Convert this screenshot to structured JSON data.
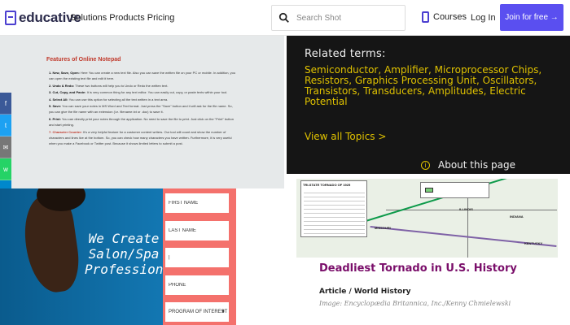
{
  "header": {
    "logo_text": "educative",
    "nav_links": "Solutions Products Pricing",
    "search_placeholder": "Search Shot",
    "courses_label": "Courses",
    "login_label": "Log In",
    "join_label": "Join for free  →"
  },
  "share_bar": {
    "items": [
      {
        "icon": "facebook-icon",
        "glyph": "f",
        "color": "#3b5998"
      },
      {
        "icon": "twitter-icon",
        "glyph": "t",
        "color": "#1da1f2"
      },
      {
        "icon": "email-icon",
        "glyph": "✉",
        "color": "#777777"
      },
      {
        "icon": "whatsapp-icon",
        "glyph": "w",
        "color": "#25d366"
      },
      {
        "icon": "telegram-icon",
        "glyph": "◄",
        "color": "#0088cc"
      }
    ]
  },
  "notepad": {
    "title": "Features of Online Notepad",
    "items": [
      {
        "bold": "1. New, Save, Open:",
        "text": " Here You can create a new text file. Also you can save the written file on your PC or mobile. In addition, you can open the existing text file and edit it here."
      },
      {
        "bold": "2. Undo & Redo:",
        "text": " These two buttons will help you to Undo or Redo the written text."
      },
      {
        "bold": "3. Cut, Copy, and Paste:",
        "text": " It is very common thing for any text editor. You can easily cut, copy, or paste texts within your tool."
      },
      {
        "bold": "4. Select All:",
        "text": " You can use this option for selecting all the text written in a text area."
      },
      {
        "bold": "5. Save:",
        "text": " You can save your notes in MS Word and Text format. Just press the \"Save\" button and it will ask for the file name. So, you can give the file name with an extension (i.e. filename.txt or .doc) to save it."
      },
      {
        "bold": "6. Print:",
        "text": " You can directly print your notes through the application. No need to save the file to print. Just click on the \"Print\" button and start printing."
      },
      {
        "bold": "7. Character Counter:",
        "text": " It's a very helpful feature for a customer content writers. Our tool will count and show the number of characters and lines live at the bottom. So, you can check how many characters you have written. Furthermore, it is very useful when you make a Facebook or Twitter post. Because it shows limited letters to submit a post.",
        "red": true
      }
    ]
  },
  "related": {
    "heading": "Related terms:",
    "terms": "Semiconductor, Amplifier, Microprocessor Chips, Resistors, Graphics Processing Unit, Oscillators, Transistors, Transducers, Amplitudes, Electric Potential",
    "view_all": "View all Topics  >",
    "about": "About this page"
  },
  "salon": {
    "tagline": "We Create Salon/Spa Professionals",
    "fields": [
      {
        "name": "first-name-field",
        "placeholder": "FIRST NAME"
      },
      {
        "name": "last-name-field",
        "placeholder": "LAST NAME"
      },
      {
        "name": "email-field",
        "placeholder": "|"
      },
      {
        "name": "phone-field",
        "placeholder": "PHONE"
      }
    ],
    "program_select": "PROGRAM OF INTEREST"
  },
  "tornado": {
    "legend_title": "TRI-STATE TORNADO OF 1925",
    "states": [
      "ILLINOIS",
      "MISSOURI",
      "INDIANA",
      "KENTUCKY"
    ],
    "title": "Deadliest Tornado in U.S. History",
    "type": "Article / World History",
    "credit": "Image: Encyclopædia Britannica, Inc./Kenny Chmielewski"
  },
  "colors": {
    "brand": "#5a4ff0",
    "accent_yellow": "#e0c200",
    "salon_coral": "#f4716c",
    "tornado_purple": "#7a0e6a"
  }
}
